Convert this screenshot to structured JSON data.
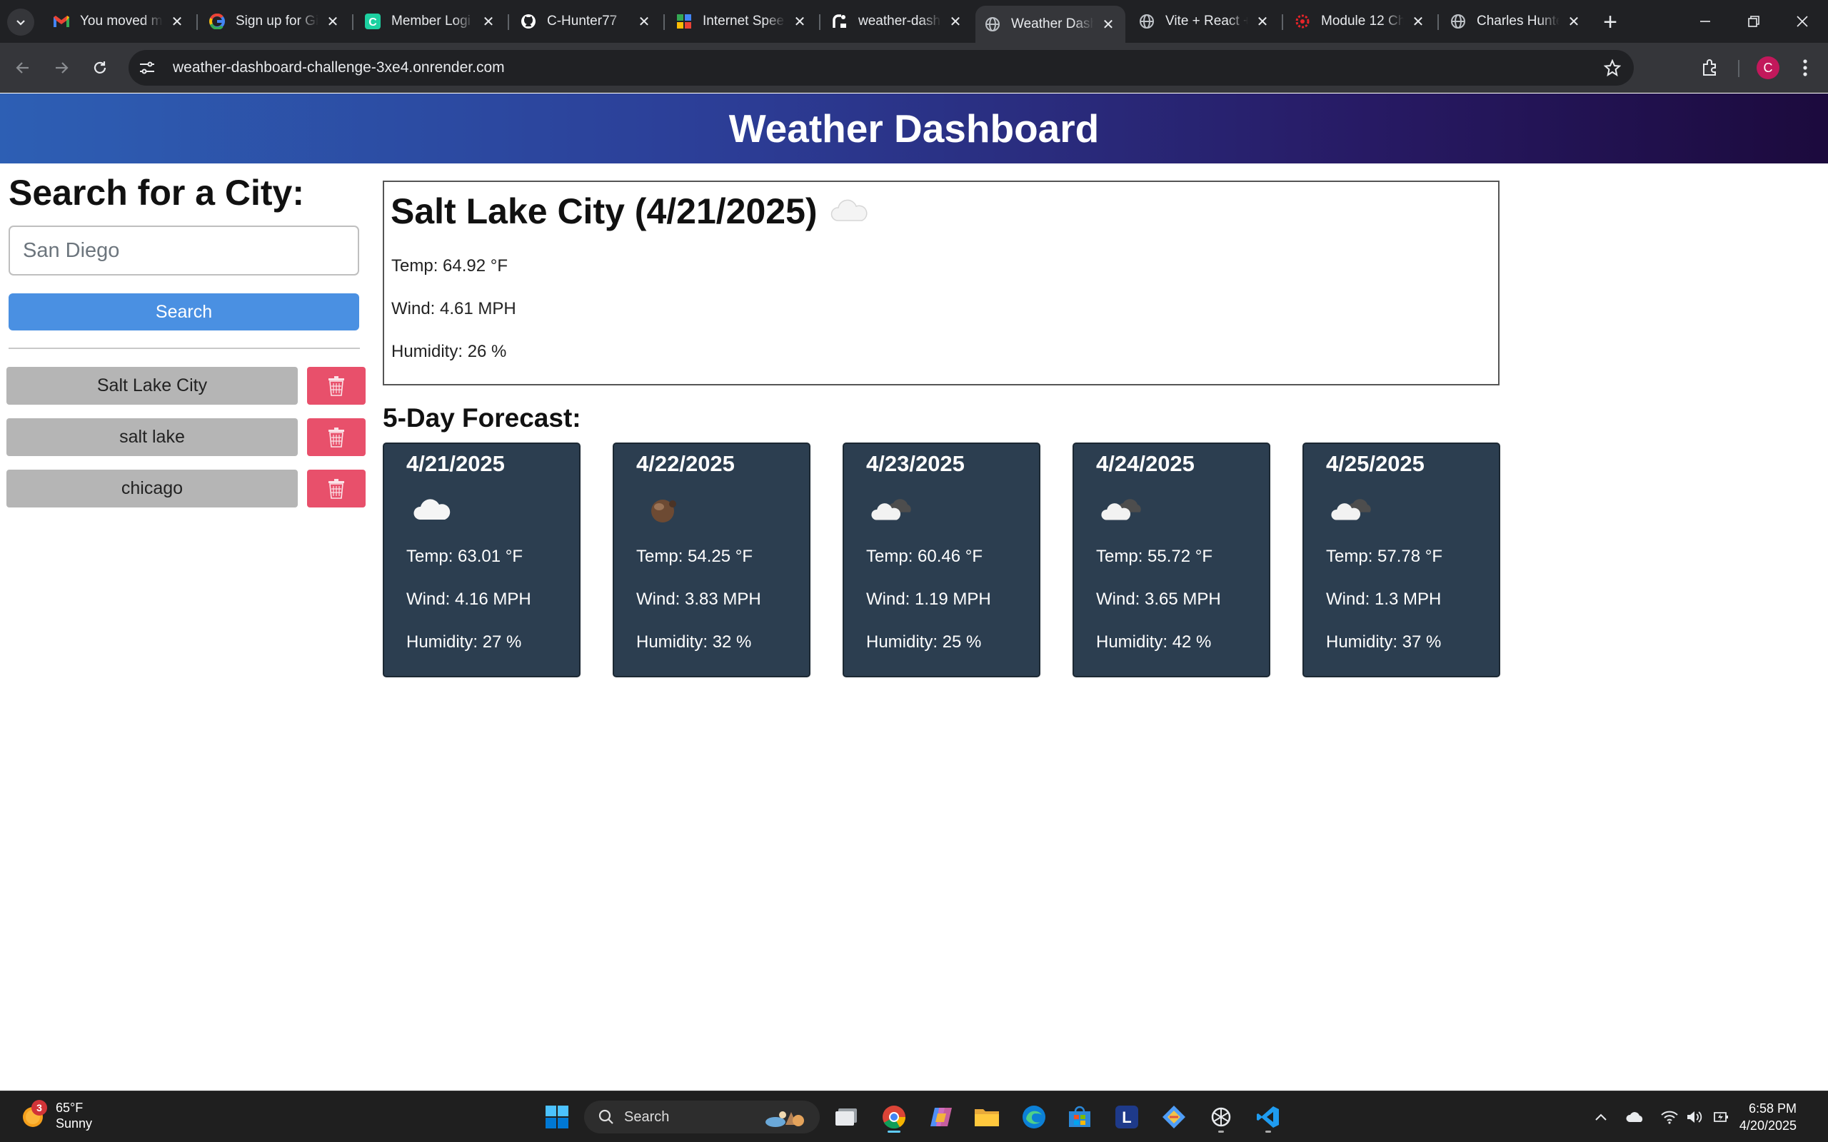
{
  "browser": {
    "tabs": [
      {
        "title": "You moved m",
        "icon": "gmail-icon",
        "active": false
      },
      {
        "title": "Sign up for Gi",
        "icon": "google-icon",
        "active": false
      },
      {
        "title": "Member Logi",
        "icon": "canva-icon",
        "active": false
      },
      {
        "title": "C-Hunter77",
        "icon": "github-icon",
        "active": false
      },
      {
        "title": "Internet Spee",
        "icon": "speedtest-icon",
        "active": false
      },
      {
        "title": "weather-dash",
        "icon": "render-icon",
        "active": false
      },
      {
        "title": "Weather Dash",
        "icon": "globe-icon",
        "active": true
      },
      {
        "title": "Vite + React +",
        "icon": "globe-icon",
        "active": false
      },
      {
        "title": "Module 12 Ch",
        "icon": "canvas-lms-icon",
        "active": false
      },
      {
        "title": "Charles Hunte",
        "icon": "globe-icon",
        "active": false
      }
    ],
    "url": "weather-dashboard-challenge-3xe4.onrender.com",
    "profile_initial": "C"
  },
  "app": {
    "title": "Weather Dashboard",
    "search": {
      "heading": "Search for a City:",
      "placeholder": "San Diego",
      "button_label": "Search"
    },
    "history": [
      "Salt Lake City",
      "salt lake",
      "chicago"
    ],
    "today": {
      "heading": "Salt Lake City (4/21/2025)",
      "icon": "cloud-icon",
      "temp": "Temp: 64.92 °F",
      "wind": "Wind: 4.61 MPH",
      "humidity": "Humidity: 26 %"
    },
    "forecast_title": "5-Day Forecast:",
    "forecast": [
      {
        "date": "4/21/2025",
        "icon": "cloud-icon",
        "temp": "Temp: 63.01 °F",
        "wind": "Wind: 4.16 MPH",
        "humidity": "Humidity: 27 %"
      },
      {
        "date": "4/22/2025",
        "icon": "dark-cloud-icon",
        "temp": "Temp: 54.25 °F",
        "wind": "Wind: 3.83 MPH",
        "humidity": "Humidity: 32 %"
      },
      {
        "date": "4/23/2025",
        "icon": "broken-clouds-icon",
        "temp": "Temp: 60.46 °F",
        "wind": "Wind: 1.19 MPH",
        "humidity": "Humidity: 25 %"
      },
      {
        "date": "4/24/2025",
        "icon": "broken-clouds-icon",
        "temp": "Temp: 55.72 °F",
        "wind": "Wind: 3.65 MPH",
        "humidity": "Humidity: 42 %"
      },
      {
        "date": "4/25/2025",
        "icon": "broken-clouds-icon",
        "temp": "Temp: 57.78 °F",
        "wind": "Wind: 1.3 MPH",
        "humidity": "Humidity: 37 %"
      }
    ]
  },
  "taskbar": {
    "weather_badge": "3",
    "weather_temp": "65°F",
    "weather_desc": "Sunny",
    "search_label": "Search",
    "time": "6:58 PM",
    "date": "4/20/2025"
  },
  "colors": {
    "search_button": "#4a90e2",
    "delete_button": "#e8506b",
    "history_button": "#b5b5b5",
    "forecast_card": "#2c3e50"
  }
}
